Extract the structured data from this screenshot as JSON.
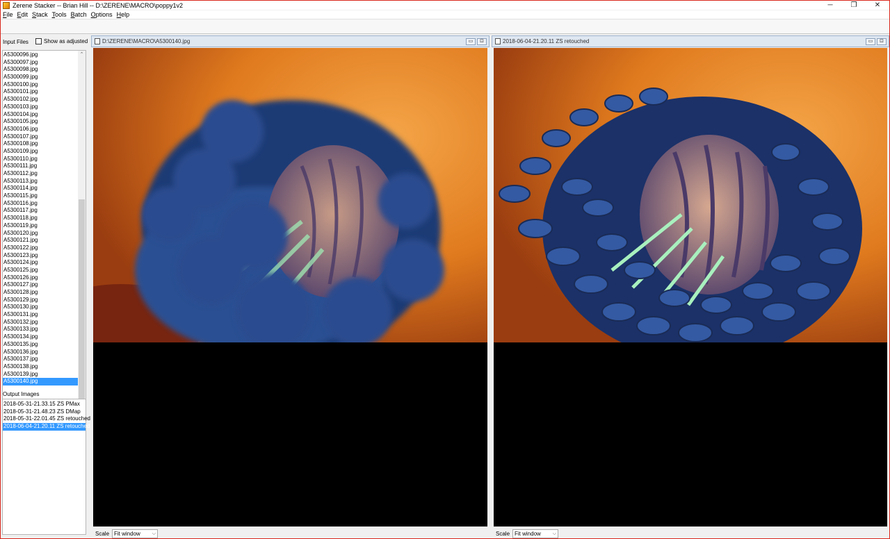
{
  "window": {
    "title": "Zerene Stacker -- Brian Hill -- D:\\ZERENE\\MACRO\\poppy1v2",
    "minimize": "─",
    "restore": "❐",
    "close": "✕"
  },
  "menu": [
    "File",
    "Edit",
    "Stack",
    "Tools",
    "Batch",
    "Options",
    "Help"
  ],
  "left_pane": {
    "input_label": "Input Files",
    "show_adjusted_label": "Show as adjusted",
    "input_files": [
      "A5300096.jpg",
      "A5300097.jpg",
      "A5300098.jpg",
      "A5300099.jpg",
      "A5300100.jpg",
      "A5300101.jpg",
      "A5300102.jpg",
      "A5300103.jpg",
      "A5300104.jpg",
      "A5300105.jpg",
      "A5300106.jpg",
      "A5300107.jpg",
      "A5300108.jpg",
      "A5300109.jpg",
      "A5300110.jpg",
      "A5300111.jpg",
      "A5300112.jpg",
      "A5300113.jpg",
      "A5300114.jpg",
      "A5300115.jpg",
      "A5300116.jpg",
      "A5300117.jpg",
      "A5300118.jpg",
      "A5300119.jpg",
      "A5300120.jpg",
      "A5300121.jpg",
      "A5300122.jpg",
      "A5300123.jpg",
      "A5300124.jpg",
      "A5300125.jpg",
      "A5300126.jpg",
      "A5300127.jpg",
      "A5300128.jpg",
      "A5300129.jpg",
      "A5300130.jpg",
      "A5300131.jpg",
      "A5300132.jpg",
      "A5300133.jpg",
      "A5300134.jpg",
      "A5300135.jpg",
      "A5300136.jpg",
      "A5300137.jpg",
      "A5300138.jpg",
      "A5300139.jpg",
      "A5300140.jpg"
    ],
    "selected_input": "A5300140.jpg",
    "output_label": "Output Images",
    "output_images": [
      "2018-05-31-21.33.15 ZS PMax",
      "2018-05-31-21.48.23 ZS DMap",
      "2018-05-31-22.01.45 ZS retouched",
      "2018-06-04-21.20.11 ZS retouched"
    ],
    "selected_output": "2018-06-04-21.20.11 ZS retouched"
  },
  "left_image_pane": {
    "title": "D:\\ZERENE\\MACRO\\A5300140.jpg",
    "scale_label": "Scale",
    "scale_value": "Fit window"
  },
  "right_image_pane": {
    "title": "2018-06-04-21.20.11 ZS retouched",
    "scale_label": "Scale",
    "scale_value": "Fit window"
  },
  "icons": {
    "app": "app-icon",
    "pane_minimize": "▭",
    "pane_maximize": "⊡",
    "dropdown": "⌵",
    "scroll_up": "⌃",
    "scroll_down": "⌄"
  },
  "colors": {
    "selection": "#3399ff",
    "frame_border": "#d9281d",
    "photo_background": "#e98a2a",
    "stamens": "#2f4f86"
  }
}
